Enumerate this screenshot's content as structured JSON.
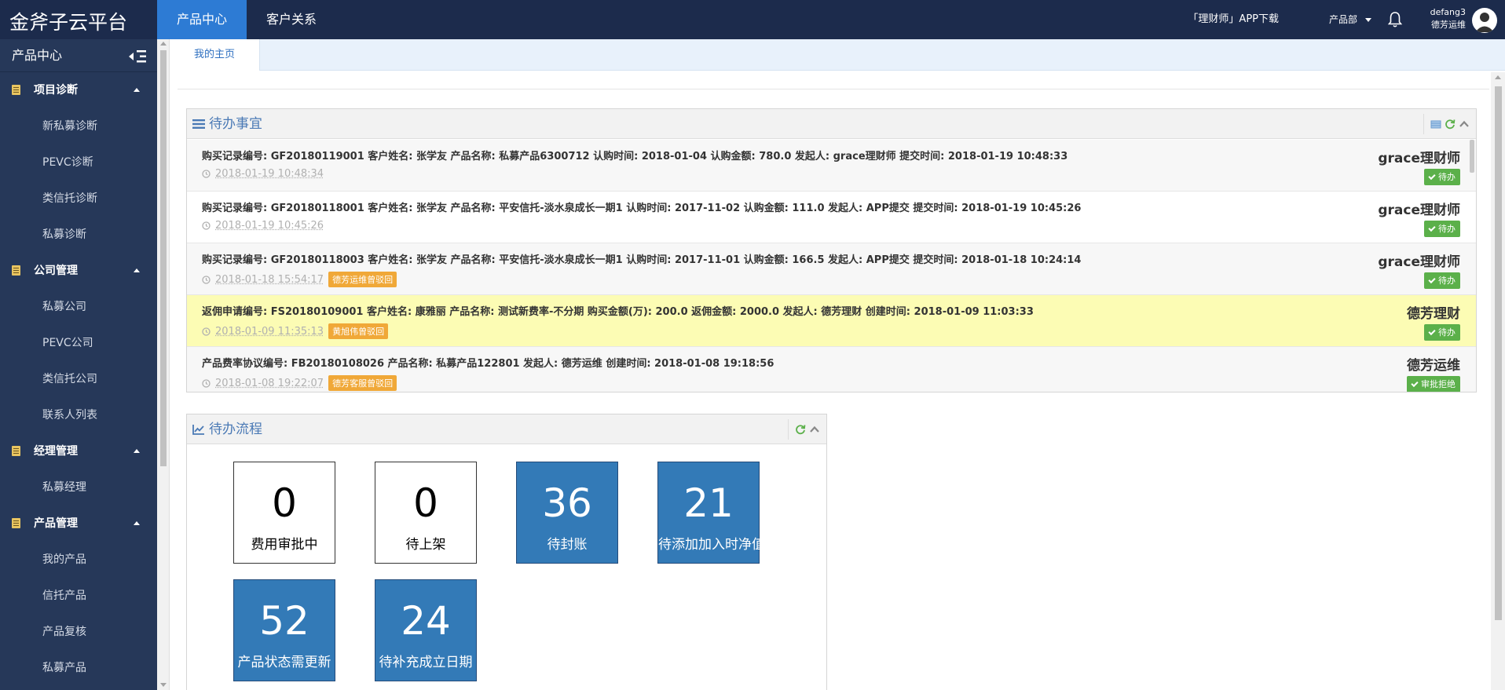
{
  "brand": "金斧子云平台",
  "topnav": [
    {
      "label": "产品中心",
      "active": true
    },
    {
      "label": "客户关系",
      "active": false
    }
  ],
  "header": {
    "app_download": "「理财师」APP下载",
    "department": "产品部",
    "username": "defang3",
    "user_role": "德芳运维"
  },
  "sidebar": {
    "title": "产品中心",
    "groups": [
      {
        "label": "项目诊断",
        "items": [
          "新私募诊断",
          "PEVC诊断",
          "类信托诊断",
          "私募诊断"
        ]
      },
      {
        "label": "公司管理",
        "items": [
          "私募公司",
          "PEVC公司",
          "类信托公司",
          "联系人列表"
        ]
      },
      {
        "label": "经理管理",
        "items": [
          "私募经理"
        ]
      },
      {
        "label": "产品管理",
        "items": [
          "我的产品",
          "信托产品",
          "产品复核",
          "私募产品"
        ]
      }
    ]
  },
  "page_tab": "我的主页",
  "todo": {
    "title": "待办事宜",
    "rows": [
      {
        "desc": "购买记录编号: GF20180119001 客户姓名: 张学友 产品名称: 私募产品6300712 认购时间: 2018-01-04 认购金额: 780.0 发起人: grace理财师 提交时间: 2018-01-19 10:48:33",
        "time": "2018-01-19 10:48:34",
        "tag": "",
        "who": "grace理财师",
        "button": "待办",
        "style": "alt"
      },
      {
        "desc": "购买记录编号: GF20180118001 客户姓名: 张学友 产品名称: 平安信托-淡水泉成长一期1 认购时间: 2017-11-02 认购金额: 111.0 发起人: APP提交 提交时间: 2018-01-19 10:45:26",
        "time": "2018-01-19 10:45:26",
        "tag": "",
        "who": "grace理财师",
        "button": "待办",
        "style": "plain"
      },
      {
        "desc": "购买记录编号: GF20180118003 客户姓名: 张学友 产品名称: 平安信托-淡水泉成长一期1 认购时间: 2017-11-01 认购金额: 166.5 发起人: APP提交 提交时间: 2018-01-18 10:24:14",
        "time": "2018-01-18 15:54:17",
        "tag": "德芳运维曾驳回",
        "who": "grace理财师",
        "button": "待办",
        "style": "alt"
      },
      {
        "desc": "返佣申请编号: FS20180109001 客户姓名: 康雅丽 产品名称: 测试新费率-不分期 购买金额(万): 200.0 返佣金额: 2000.0 发起人: 德芳理财 创建时间: 2018-01-09 11:03:33",
        "time": "2018-01-09 11:35:13",
        "tag": "黄旭伟曾驳回",
        "who": "德芳理财",
        "button": "待办",
        "style": "hl"
      },
      {
        "desc": "产品费率协议编号: FB20180108026 产品名称: 私募产品122801 发起人: 德芳运维 创建时间: 2018-01-08 19:18:56",
        "time": "2018-01-08 19:22:07",
        "tag": "德芳客服曾驳回",
        "who": "德芳运维",
        "button": "审批拒绝",
        "style": "alt"
      }
    ]
  },
  "process": {
    "title": "待办流程",
    "tiles": [
      {
        "value": "0",
        "label": "费用审批中",
        "style": "white"
      },
      {
        "value": "0",
        "label": "待上架",
        "style": "white"
      },
      {
        "value": "36",
        "label": "待封账",
        "style": "blue"
      },
      {
        "value": "21",
        "label": "待添加加入时净值",
        "style": "blue"
      },
      {
        "value": "52",
        "label": "产品状态需更新",
        "style": "blue"
      },
      {
        "value": "24",
        "label": "待补充成立日期",
        "style": "blue"
      }
    ]
  },
  "icons": {
    "sidebar_toggle": "indent-icon",
    "group": "file-icon",
    "todo_header": "list-icon",
    "process_header": "line-chart-icon",
    "time": "clock-icon",
    "notification": "bell-icon",
    "check": "check-icon"
  },
  "colors": {
    "topbar": "#1c2b4c",
    "sidebar": "#263859",
    "active_tab": "#2d7bd4",
    "tile_blue": "#337ab7",
    "action_green": "#5bb04a",
    "tag_orange": "#f0a838",
    "highlight_row": "#fcfcb4"
  }
}
